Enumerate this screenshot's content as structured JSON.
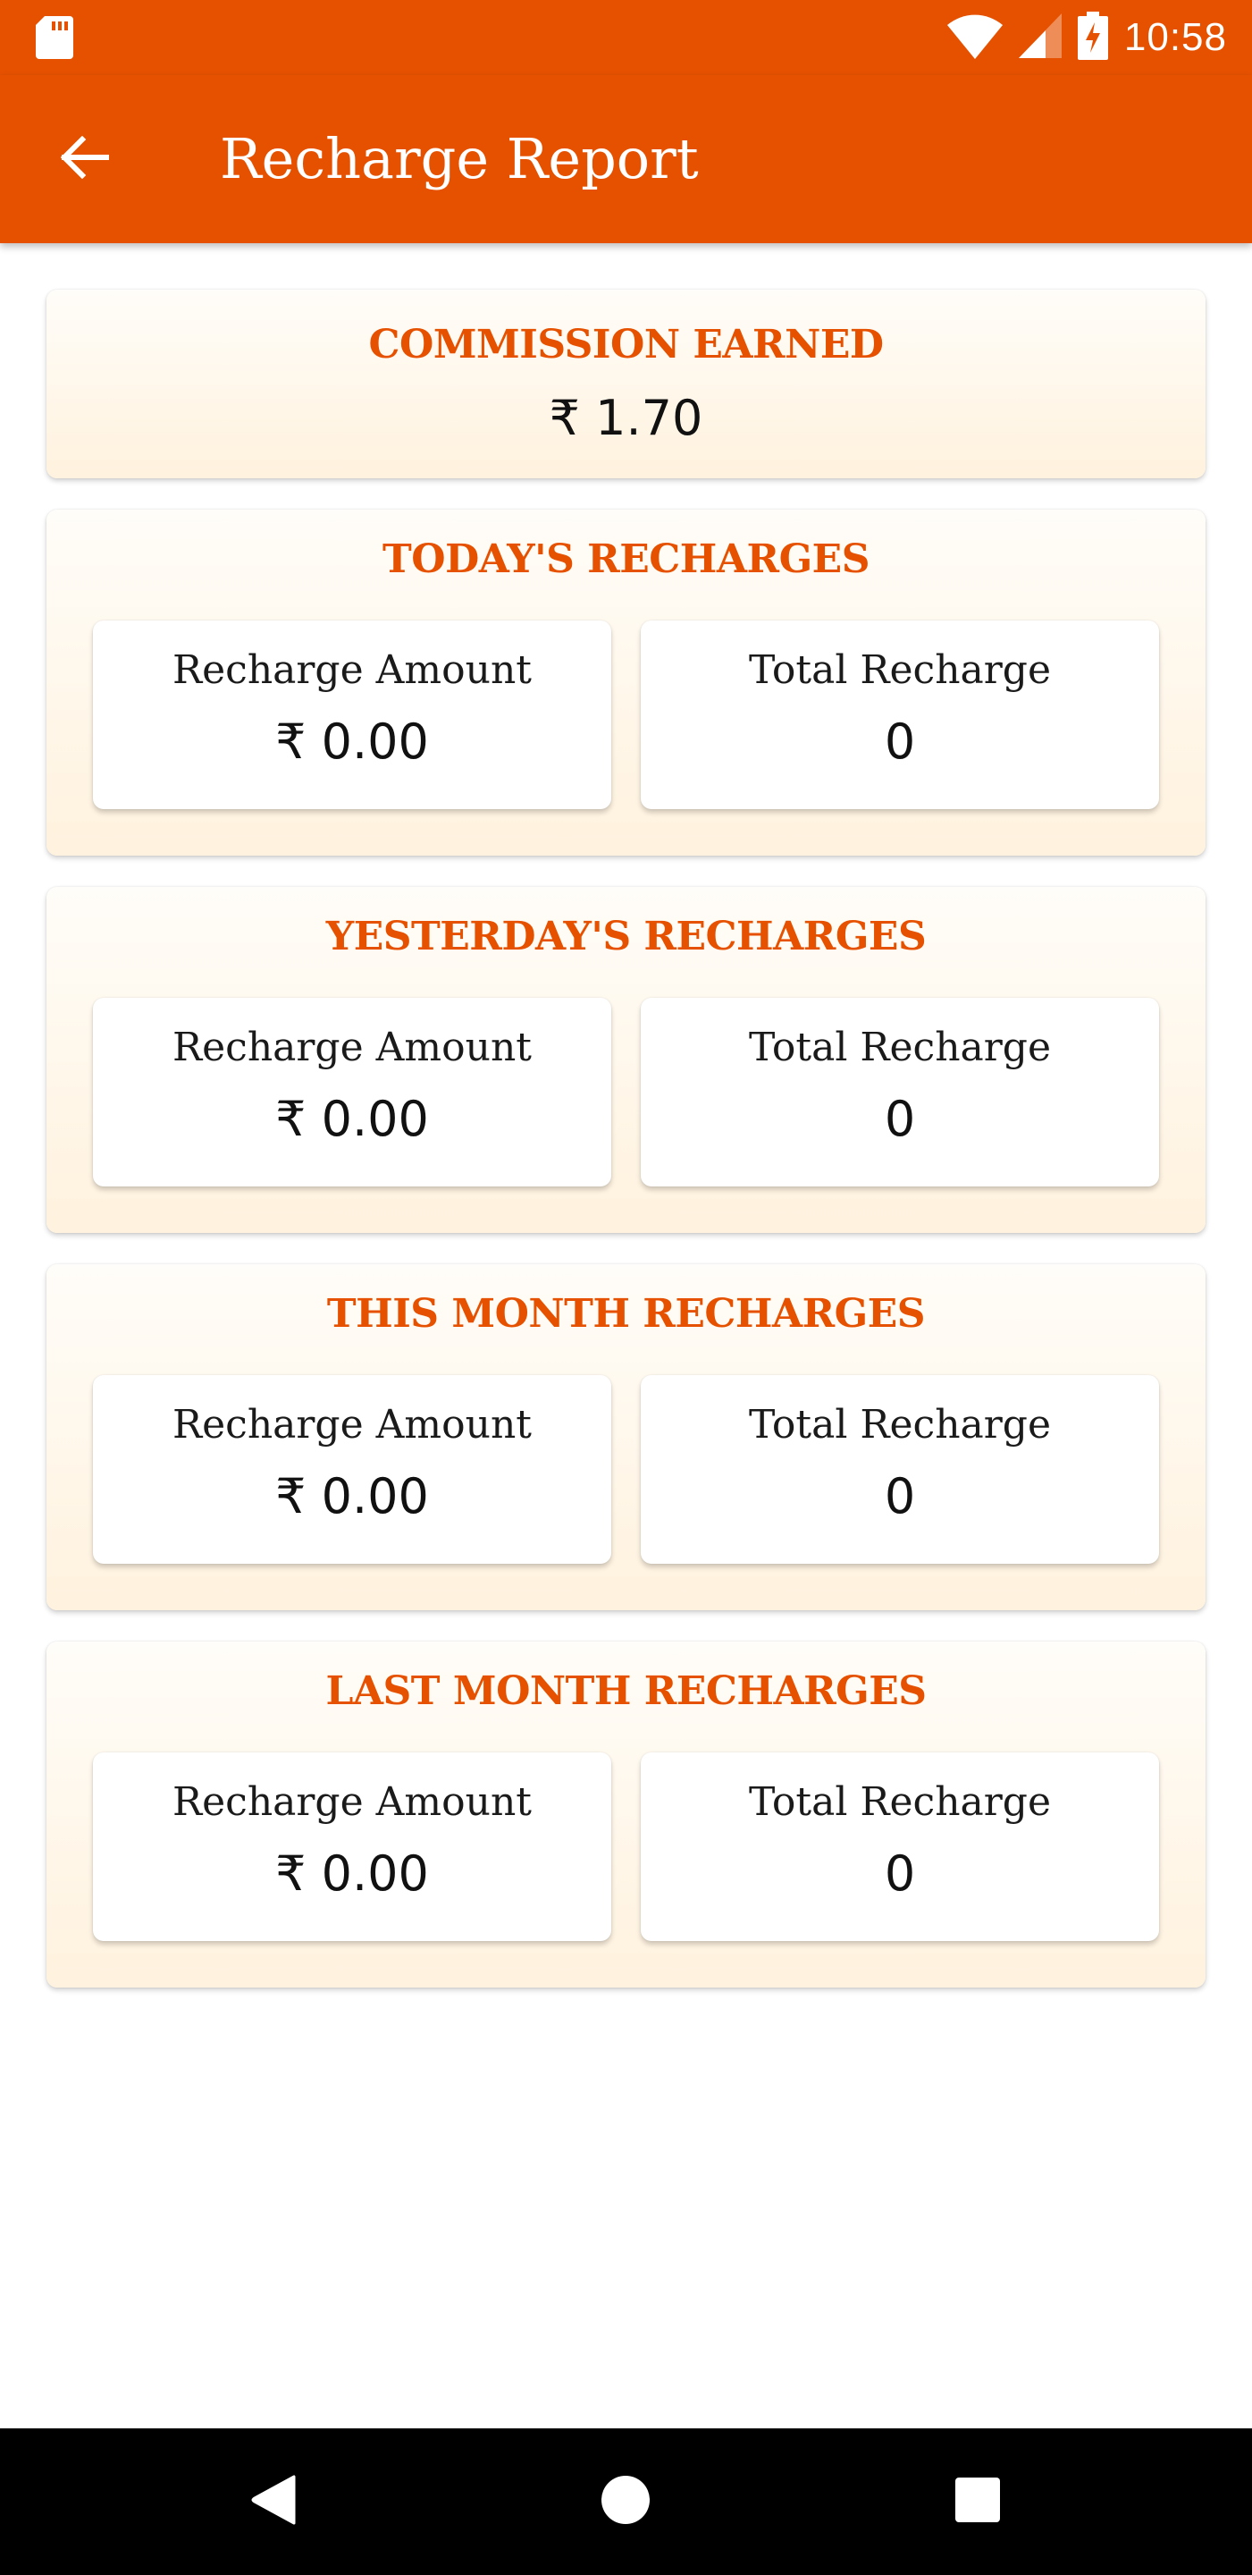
{
  "status_bar": {
    "time": "10:58",
    "icons": [
      "sd-card-icon",
      "wifi-icon",
      "cell-signal-icon",
      "battery-charging-icon"
    ]
  },
  "toolbar": {
    "title": "Recharge Report",
    "back_icon": "arrow-left-icon"
  },
  "colors": {
    "primary": "#E65100",
    "card_bg_top": "#fffdf9",
    "card_bg_bottom": "#fff2de",
    "text_dark": "#111111"
  },
  "commission": {
    "title": "COMMISSION EARNED",
    "value": "₹ 1.70"
  },
  "sections": [
    {
      "title": "TODAY'S RECHARGES",
      "amount_label": "Recharge Amount",
      "amount_value": "₹ 0.00",
      "count_label": "Total Recharge",
      "count_value": "0"
    },
    {
      "title": "YESTERDAY'S RECHARGES",
      "amount_label": "Recharge Amount",
      "amount_value": "₹ 0.00",
      "count_label": "Total Recharge",
      "count_value": "0"
    },
    {
      "title": "THIS MONTH RECHARGES",
      "amount_label": "Recharge Amount",
      "amount_value": "₹ 0.00",
      "count_label": "Total Recharge",
      "count_value": "0"
    },
    {
      "title": "LAST MONTH RECHARGES",
      "amount_label": "Recharge Amount",
      "amount_value": "₹ 0.00",
      "count_label": "Total Recharge",
      "count_value": "0"
    }
  ],
  "nav_bar": {
    "buttons": [
      "back-triangle-icon",
      "home-circle-icon",
      "recents-square-icon"
    ]
  }
}
